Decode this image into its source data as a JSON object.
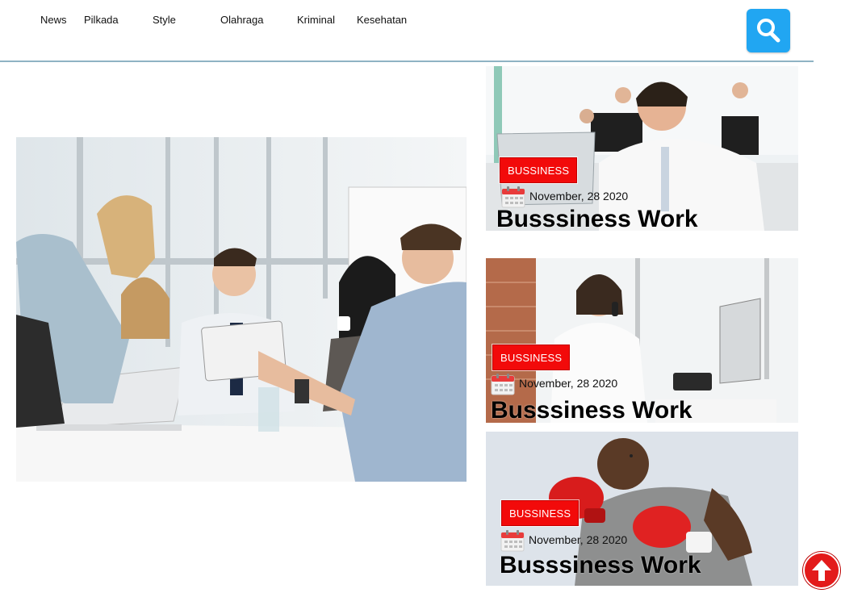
{
  "nav": {
    "items": [
      {
        "label": "News"
      },
      {
        "label": "Pilkada"
      },
      {
        "label": "Style"
      },
      {
        "label": "Olahraga"
      },
      {
        "label": "Kriminal"
      },
      {
        "label": "Kesehatan"
      }
    ],
    "search_icon": "search-icon",
    "accent": "#21a6f2"
  },
  "hero": {
    "image": "office-team-meeting-photo"
  },
  "cards": [
    {
      "category": "BUSSINESS",
      "date": "November, 28 2020",
      "title": "Busssiness Work",
      "image": "man-at-computer-office-photo"
    },
    {
      "category": "BUSSINESS",
      "date": "November, 28 2020",
      "title": "Busssiness Work",
      "image": "woman-on-phone-office-photo"
    },
    {
      "category": "BUSSINESS",
      "date": "November, 28 2020",
      "title": "Busssiness Work",
      "image": "boxer-with-gloves-photo"
    }
  ],
  "colors": {
    "badge": "#f20a0a",
    "scroll_top": "#e31b1b",
    "divider": "#8fb3c4"
  },
  "scroll_top_icon": "arrow-up-icon"
}
